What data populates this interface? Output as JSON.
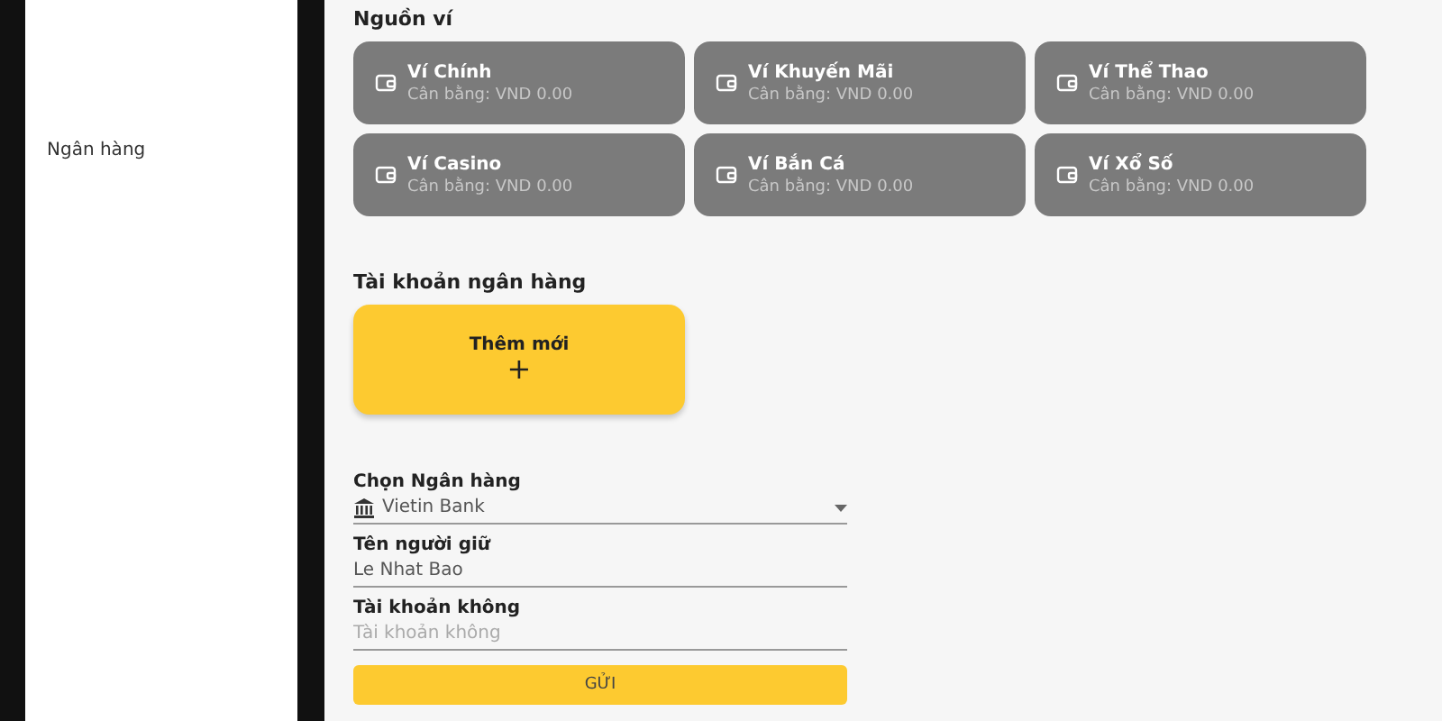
{
  "sidebar": {
    "items": [
      {
        "label": "Ngân hàng"
      }
    ]
  },
  "wallets": {
    "title": "Nguồn ví",
    "items": [
      {
        "name": "Ví Chính",
        "balance": "Cân bằng: VND 0.00"
      },
      {
        "name": "Ví Khuyến Mãi",
        "balance": "Cân bằng: VND 0.00"
      },
      {
        "name": "Ví Thể Thao",
        "balance": "Cân bằng: VND 0.00"
      },
      {
        "name": "Ví Casino",
        "balance": "Cân bằng: VND 0.00"
      },
      {
        "name": "Ví Bắn Cá",
        "balance": "Cân bằng: VND 0.00"
      },
      {
        "name": "Ví Xổ Số",
        "balance": "Cân bằng: VND 0.00"
      }
    ]
  },
  "bank_accounts": {
    "title": "Tài khoản ngân hàng",
    "add_label": "Thêm mới",
    "add_symbol": "+"
  },
  "form": {
    "fields": [
      {
        "kind": "select",
        "label": "Chọn Ngân hàng",
        "value": "Vietin Bank"
      },
      {
        "kind": "text",
        "label": "Tên người giữ",
        "value": "Le Nhat Bao"
      },
      {
        "kind": "text",
        "label": "Tài khoản không",
        "placeholder": "Tài khoản không"
      }
    ],
    "submit": "GỬI"
  }
}
